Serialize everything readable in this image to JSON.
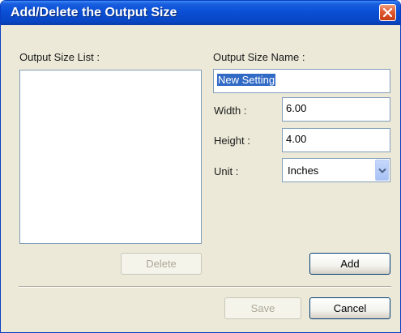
{
  "window": {
    "title": "Add/Delete the Output Size"
  },
  "list": {
    "label": "Output Size List :",
    "items": []
  },
  "form": {
    "name_label": "Output Size Name :",
    "name_value": "New Setting",
    "width_label": "Width :",
    "width_value": "6.00",
    "height_label": "Height :",
    "height_value": "4.00",
    "unit_label": "Unit :",
    "unit_value": "Inches"
  },
  "buttons": {
    "delete": "Delete",
    "add": "Add",
    "save": "Save",
    "cancel": "Cancel"
  },
  "icons": {
    "close": "close-icon",
    "dropdown": "chevron-down-icon"
  },
  "colors": {
    "titlebar": "#0a4fd6",
    "selection": "#316ac5",
    "close_button": "#e05a32"
  }
}
